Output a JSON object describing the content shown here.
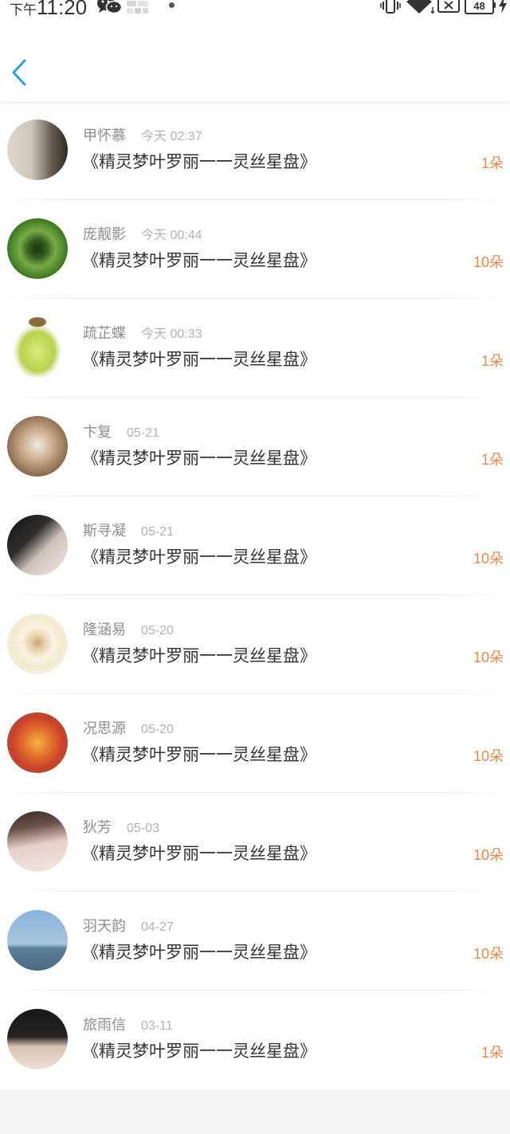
{
  "status_bar": {
    "time_period": "下午",
    "time": "11:20",
    "battery_level": "48",
    "icons": [
      "wechat-icon",
      "app-notification-icon",
      "more-notifications-dot",
      "vibrate-icon",
      "wifi-icon",
      "sim-no-service-icon",
      "battery-icon",
      "charging-bolt-icon"
    ]
  },
  "header": {
    "back_icon": "back-chevron-icon"
  },
  "colors": {
    "accent": "#2e9fe6",
    "count": "#e8894b",
    "name": "#8e8e8e",
    "time": "#b3b3b3",
    "title": "#333333",
    "page_background": "#f4f4f4"
  },
  "records": [
    {
      "name": "甲怀慕",
      "time": "今天 02:37",
      "title": "《精灵梦叶罗丽一一灵丝星盘》",
      "count": "1朵"
    },
    {
      "name": "庞靓影",
      "time": "今天 00:44",
      "title": "《精灵梦叶罗丽一一灵丝星盘》",
      "count": "10朵"
    },
    {
      "name": "疏芷蝶",
      "time": "今天 00:33",
      "title": "《精灵梦叶罗丽一一灵丝星盘》",
      "count": "1朵"
    },
    {
      "name": "卞复",
      "time": "05-21",
      "title": "《精灵梦叶罗丽一一灵丝星盘》",
      "count": "1朵"
    },
    {
      "name": "斯寻凝",
      "time": "05-21",
      "title": "《精灵梦叶罗丽一一灵丝星盘》",
      "count": "10朵"
    },
    {
      "name": "隆涵易",
      "time": "05-20",
      "title": "《精灵梦叶罗丽一一灵丝星盘》",
      "count": "10朵"
    },
    {
      "name": "况思源",
      "time": "05-20",
      "title": "《精灵梦叶罗丽一一灵丝星盘》",
      "count": "10朵"
    },
    {
      "name": "狄芳",
      "time": "05-03",
      "title": "《精灵梦叶罗丽一一灵丝星盘》",
      "count": "10朵"
    },
    {
      "name": "羽天韵",
      "time": "04-27",
      "title": "《精灵梦叶罗丽一一灵丝星盘》",
      "count": "10朵"
    },
    {
      "name": "旅雨信",
      "time": "03-11",
      "title": "《精灵梦叶罗丽一一灵丝星盘》",
      "count": "1朵"
    }
  ]
}
